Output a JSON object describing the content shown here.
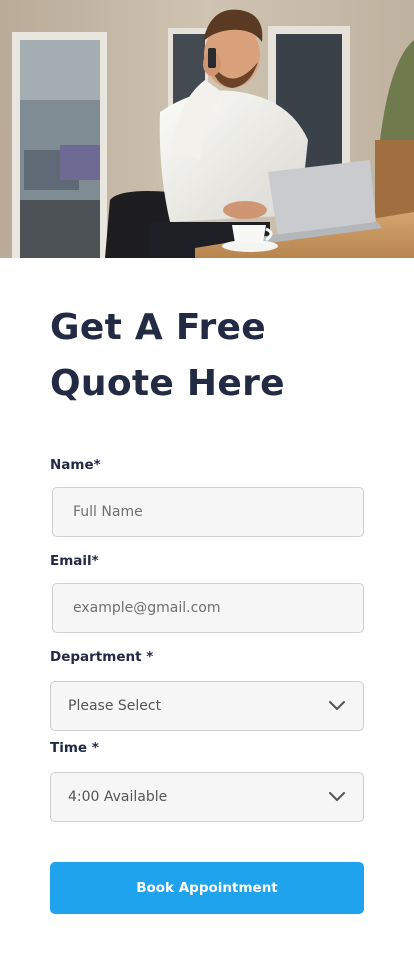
{
  "hero": {
    "image": "man-on-phone-at-desk-photo"
  },
  "form": {
    "title_line1": "Get A Free",
    "title_line2": "Quote Here",
    "name": {
      "label": "Name*",
      "placeholder": "Full Name",
      "value": ""
    },
    "email": {
      "label": "Email*",
      "placeholder": "example@gmail.com",
      "value": ""
    },
    "department": {
      "label": "Department *",
      "selected": "Please Select"
    },
    "time": {
      "label": "Time *",
      "selected": "4:00 Available"
    },
    "submit_label": "Book Appointment"
  },
  "colors": {
    "heading": "#222a44",
    "button": "#1ea3ec",
    "field_bg": "#f6f6f6",
    "field_border": "#cfcfcf"
  }
}
